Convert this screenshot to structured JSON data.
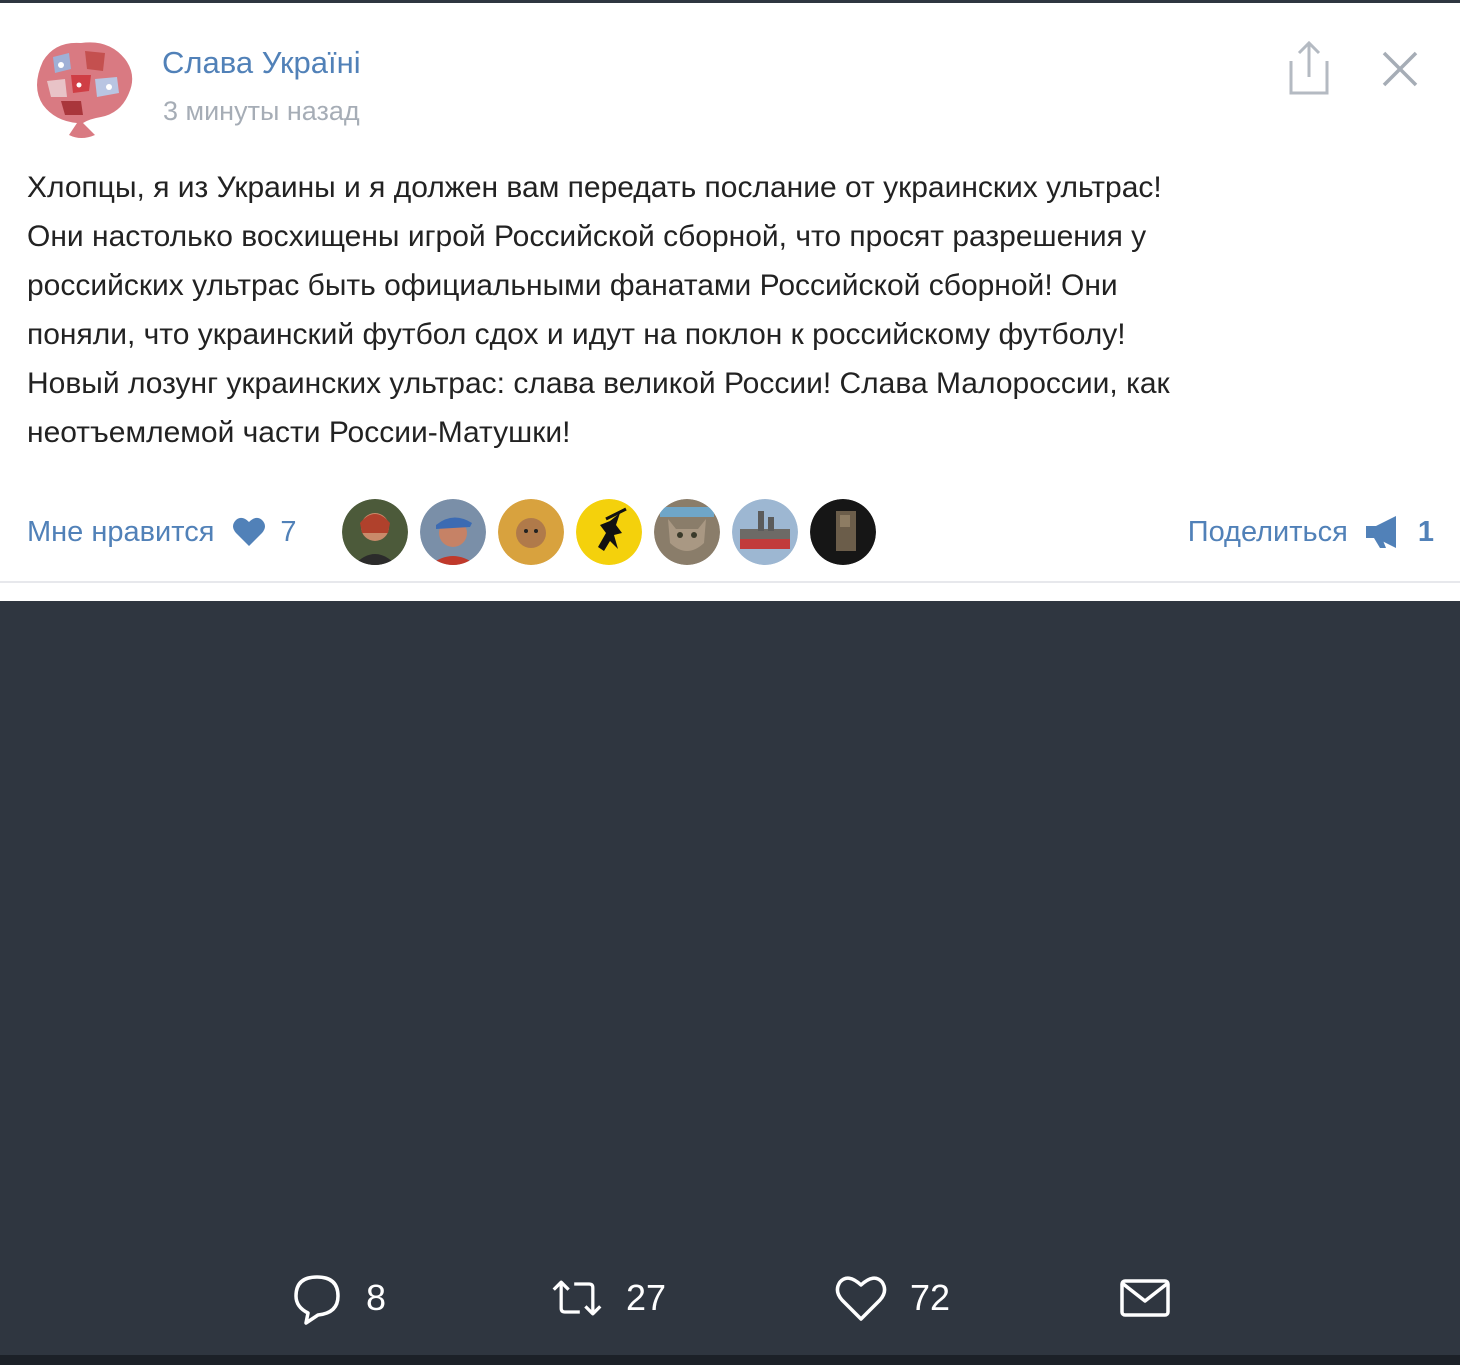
{
  "post": {
    "author": "Слава Україні",
    "time": "3 минуты назад",
    "text_lines": [
      "Хлопцы, я из Украины и я должен вам передать послание от украинских ультрас!",
      "Они настолько восхищены игрой Российской сборной, что просят разрешения у",
      "российских ультрас быть официальными фанатами Российской сборной! Они",
      "поняли, что украинский футбол сдох и идут на поклон к российскому футболу!",
      "Новый лозунг украинских ультрас: слава великой России! Слава Малороссии, как",
      "неотъемлемой части России-Матушки!"
    ],
    "like_label": "Мне нравится",
    "like_count": "7",
    "share_label": "Поделиться",
    "share_count": "1"
  },
  "icons": {
    "share": "share-upload-icon",
    "close": "close-icon",
    "like": "heart-icon",
    "repost": "megaphone-icon"
  },
  "tweet_actions": {
    "replies": "8",
    "retweets": "27",
    "likes": "72"
  },
  "colors": {
    "accent": "#5181b8",
    "muted": "#a6adb6",
    "text": "#222222",
    "dark_background": "#2f3640"
  }
}
